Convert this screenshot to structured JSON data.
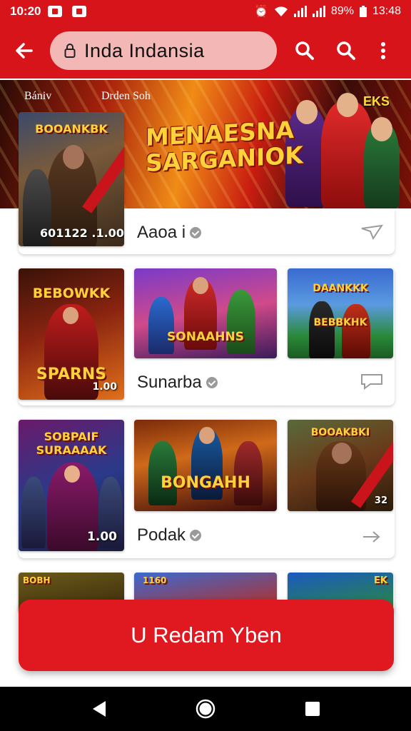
{
  "status_bar": {
    "time": "10:20",
    "battery": "89%",
    "clock_right": "13:48"
  },
  "app_bar": {
    "url_text": "Inda Indansia"
  },
  "hero": {
    "label_left": "Bániv",
    "label_mid": "Drden Soh",
    "title": "MENAESNA SARGANIOK",
    "badge": "EKS"
  },
  "cards": [
    {
      "title": "Aaoa i",
      "thumb_title": "BOOANKBK",
      "thumb_sub": "601122 .1.00"
    },
    {
      "title": "Sunarba",
      "thumbs": [
        {
          "title": "BEBOWKK",
          "sub": "SPARNS",
          "sub2": "1.00"
        },
        {
          "title": "SONAAHNS",
          "sub": ""
        },
        {
          "title": "DAANKKK",
          "sub": "BEBBKHK"
        }
      ]
    },
    {
      "title": "Podak",
      "thumbs": [
        {
          "title": "SOBPAIF SURAAAAK",
          "sub": "1.00"
        },
        {
          "title": "BONGAHH",
          "sub": ""
        },
        {
          "title": "BOOAKBKI",
          "sub": "32"
        }
      ]
    },
    {
      "thumbs": [
        {
          "title": "BOBH"
        },
        {
          "title": "1160"
        },
        {
          "title": "EK"
        }
      ]
    }
  ],
  "cta": {
    "label": "U Redam Yben"
  },
  "colors": {
    "brand_red": "#d8141b",
    "url_pill": "#f3b7b5",
    "cta_red": "#e01820"
  }
}
